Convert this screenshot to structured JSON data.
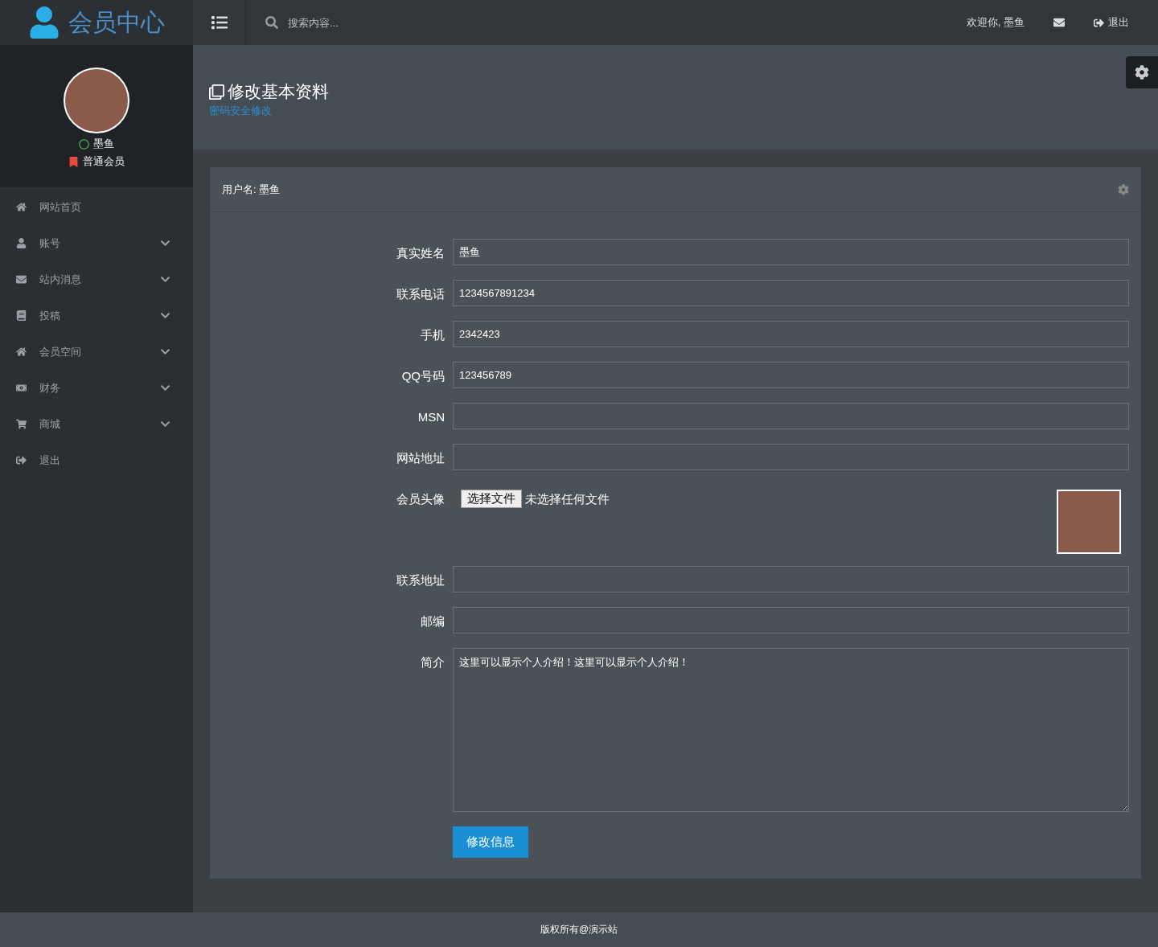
{
  "header": {
    "logo": "会员中心",
    "search": {
      "placeholder": "搜索内容..."
    },
    "welcome": "欢迎你, 墨鱼",
    "logout": "退出"
  },
  "profile": {
    "name": "墨鱼",
    "online": true,
    "level": "普通会员"
  },
  "sidebar": {
    "items": [
      {
        "label": "网站首页",
        "expandable": false
      },
      {
        "label": "账号",
        "expandable": true
      },
      {
        "label": "站内消息",
        "expandable": true
      },
      {
        "label": "投稿",
        "expandable": true
      },
      {
        "label": "会员空间",
        "expandable": true
      },
      {
        "label": "财务",
        "expandable": true
      },
      {
        "label": "商城",
        "expandable": true
      },
      {
        "label": "退出",
        "expandable": false
      }
    ]
  },
  "page": {
    "title": "修改基本资料",
    "link": "密码安全修改"
  },
  "panel": {
    "title": "用户名: 墨鱼",
    "fields": [
      {
        "kind": "text",
        "label": "真实姓名",
        "value": "墨鱼"
      },
      {
        "kind": "text",
        "label": "联系电话",
        "value": "1234567891234"
      },
      {
        "kind": "text",
        "label": "手机",
        "value": "2342423"
      },
      {
        "kind": "text",
        "label": "QQ号码",
        "value": "123456789"
      },
      {
        "kind": "text",
        "label": "MSN"
      },
      {
        "kind": "text",
        "label": "网站地址"
      },
      {
        "kind": "file",
        "label": "会员头像",
        "button": "选择文件",
        "status": "未选择任何文件"
      },
      {
        "kind": "text",
        "label": "联系地址"
      },
      {
        "kind": "text",
        "label": "邮编"
      },
      {
        "kind": "textarea",
        "label": "简介",
        "value": "这里可以显示个人介绍！这里可以显示个人介绍！"
      }
    ],
    "submit": "修改信息"
  },
  "footer": "版权所有@演示站"
}
